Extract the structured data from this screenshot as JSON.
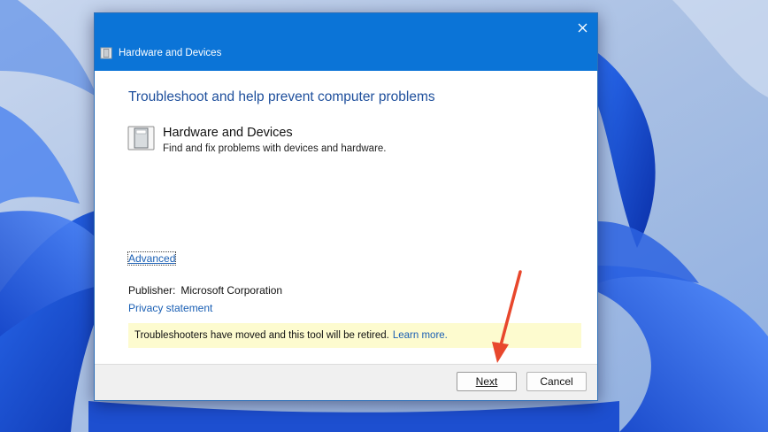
{
  "dialog": {
    "title": "Hardware and Devices",
    "heading": "Troubleshoot and help prevent computer problems",
    "item": {
      "title": "Hardware and Devices",
      "description": "Find and fix problems with devices and hardware."
    },
    "advanced_label": "Advanced",
    "publisher_label": "Publisher:",
    "publisher_value": "Microsoft Corporation",
    "privacy_label": "Privacy statement",
    "notice_text": "Troubleshooters have moved and this tool will be retired.",
    "learn_more_label": "Learn more.",
    "next_label": "Next",
    "cancel_label": "Cancel"
  },
  "colors": {
    "titlebar": "#0b74d7",
    "heading": "#1e4f9c",
    "link": "#1a5fb4",
    "notice_bg": "#fdfbcf",
    "annotation_arrow": "#e8472c"
  },
  "icons": {
    "close": "close-icon",
    "title": "hardware-devices-icon",
    "item": "hardware-devices-icon"
  }
}
